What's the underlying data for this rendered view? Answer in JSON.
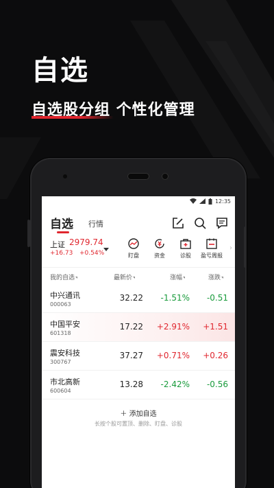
{
  "hero": {
    "title": "自选",
    "subtitle": "自选股分组 个性化管理"
  },
  "status": {
    "time": "12:35"
  },
  "tabs": {
    "watchlist": "自选",
    "market": "行情"
  },
  "index": {
    "name": "上证",
    "price": "2979.74",
    "change": "+16.73",
    "percent": "+0.54%"
  },
  "tools": [
    {
      "label": "盯盘",
      "icon": "monitor-icon"
    },
    {
      "label": "资金",
      "icon": "fund-icon"
    },
    {
      "label": "诊股",
      "icon": "diagnose-icon"
    },
    {
      "label": "盈亏周报",
      "icon": "calendar-report-icon"
    }
  ],
  "table": {
    "headers": {
      "name": "我的自选",
      "price": "最新价",
      "pct": "涨幅",
      "chg": "涨跌"
    },
    "rows": [
      {
        "name": "中兴通讯",
        "code": "000063",
        "price": "32.22",
        "pct": "-1.51%",
        "chg": "-0.51",
        "dir": "down"
      },
      {
        "name": "中国平安",
        "code": "601318",
        "price": "17.22",
        "pct": "+2.91%",
        "chg": "+1.51",
        "dir": "up"
      },
      {
        "name": "震安科技",
        "code": "300767",
        "price": "37.27",
        "pct": "+0.71%",
        "chg": "+0.26",
        "dir": "up"
      },
      {
        "name": "市北高新",
        "code": "600604",
        "price": "13.28",
        "pct": "-2.42%",
        "chg": "-0.56",
        "dir": "down"
      }
    ]
  },
  "add": {
    "label": "添加自选",
    "hint": "长按个股可置顶、删除、盯盘、诊股"
  },
  "colors": {
    "up": "#e0262e",
    "down": "#179a3a",
    "accent": "#e0262e"
  }
}
